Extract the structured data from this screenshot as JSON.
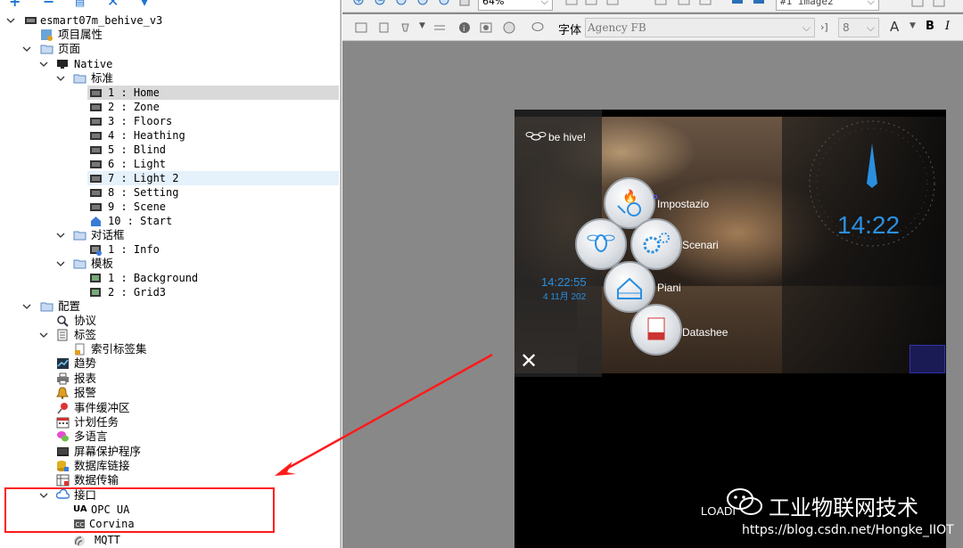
{
  "tree": {
    "root": "esmart07m_behive_v3",
    "project_props": "项目属性",
    "pages": "页面",
    "native": "Native",
    "standard": "标准",
    "standard_pages": [
      {
        "label": "1 : Home",
        "selected": true
      },
      {
        "label": "2 : Zone"
      },
      {
        "label": "3 : Floors"
      },
      {
        "label": "4 : Heathing"
      },
      {
        "label": "5 : Blind"
      },
      {
        "label": "6 : Light"
      },
      {
        "label": "7 : Light 2",
        "highlighted": true
      },
      {
        "label": "8 : Setting"
      },
      {
        "label": "9 : Scene"
      },
      {
        "label": "10 : Start"
      }
    ],
    "dialogs": "对话框",
    "dialog_items": [
      {
        "label": "1 : Info"
      }
    ],
    "templates": "模板",
    "template_items": [
      {
        "label": "1 : Background"
      },
      {
        "label": "2 : Grid3"
      }
    ],
    "config": "配置",
    "protocol": "协议",
    "tags": "标签",
    "index_tagset": "索引标签集",
    "trends": "趋势",
    "reports": "报表",
    "alarms": "报警",
    "event_buffer": "事件缓冲区",
    "scheduler": "计划任务",
    "multilang": "多语言",
    "screensaver": "屏幕保护程序",
    "db_links": "数据库链接",
    "data_transfer": "数据传输",
    "interfaces": "接口",
    "opcua": "OPC UA",
    "corvina": "Corvina",
    "mqtt": "MQTT"
  },
  "toolbar": {
    "zoom": "64%",
    "widget_name": "#1 image2",
    "font_label": "字体",
    "font_name": "Agency FB",
    "font_size": "8"
  },
  "device": {
    "brand": "be hive!",
    "clock_big": "14:22",
    "clock_small": "14:22:55",
    "date_small": "4 11月 202",
    "menu": [
      "Impostazio",
      "Scenari",
      "Piani",
      "Datashee"
    ],
    "loading": "LOADI"
  },
  "watermark": {
    "title": "工业物联网技术",
    "url": "https://blog.csdn.net/Hongke_IIOT"
  },
  "colors": {
    "accent_blue": "#2b8fe0",
    "annotation_red": "#ff1a1a",
    "selection_gray": "#d9d9d9",
    "highlight_blue": "#e5f1fb"
  }
}
